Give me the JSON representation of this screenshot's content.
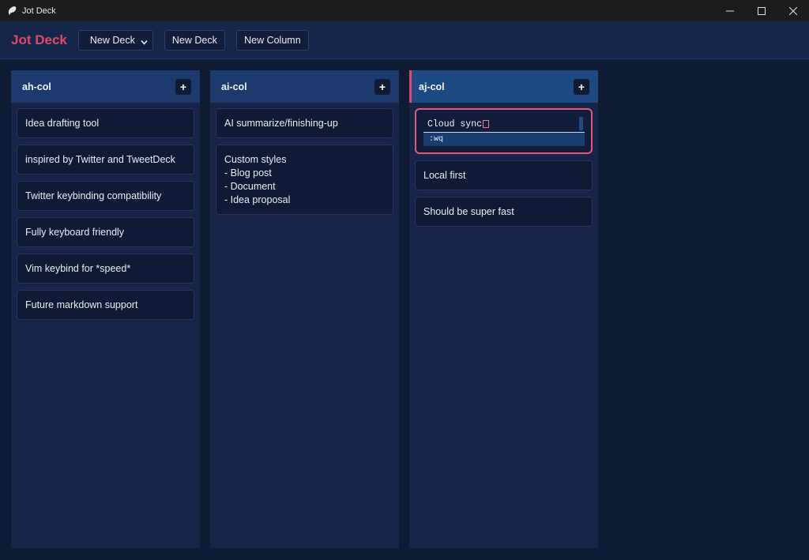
{
  "window": {
    "title": "Jot Deck"
  },
  "toolbar": {
    "brand": "Jot Deck",
    "deck_select": "New Deck",
    "new_deck_label": "New Deck",
    "new_column_label": "New Column"
  },
  "colors": {
    "brand": "#e4476a",
    "active_border": "#e4476a",
    "background": "#0f1a33"
  },
  "columns": [
    {
      "title": "ah-col",
      "add_label": "+",
      "cards": [
        "Idea drafting tool",
        "inspired by Twitter and TweetDeck",
        "Twitter keybinding compatibility",
        "Fully keyboard friendly",
        "Vim keybind for *speed*",
        "Future markdown support"
      ]
    },
    {
      "title": "ai-col",
      "add_label": "+",
      "cards": [
        "AI summarize/finishing-up"
      ],
      "multiline_card": [
        "Custom styles",
        "- Blog post",
        "- Document",
        "- Idea proposal"
      ]
    },
    {
      "title": "aj-col",
      "add_label": "+",
      "editing_card": {
        "text": "Cloud sync",
        "vim_command": ":wq"
      },
      "cards": [
        "Local first",
        "Should be super fast"
      ]
    }
  ]
}
